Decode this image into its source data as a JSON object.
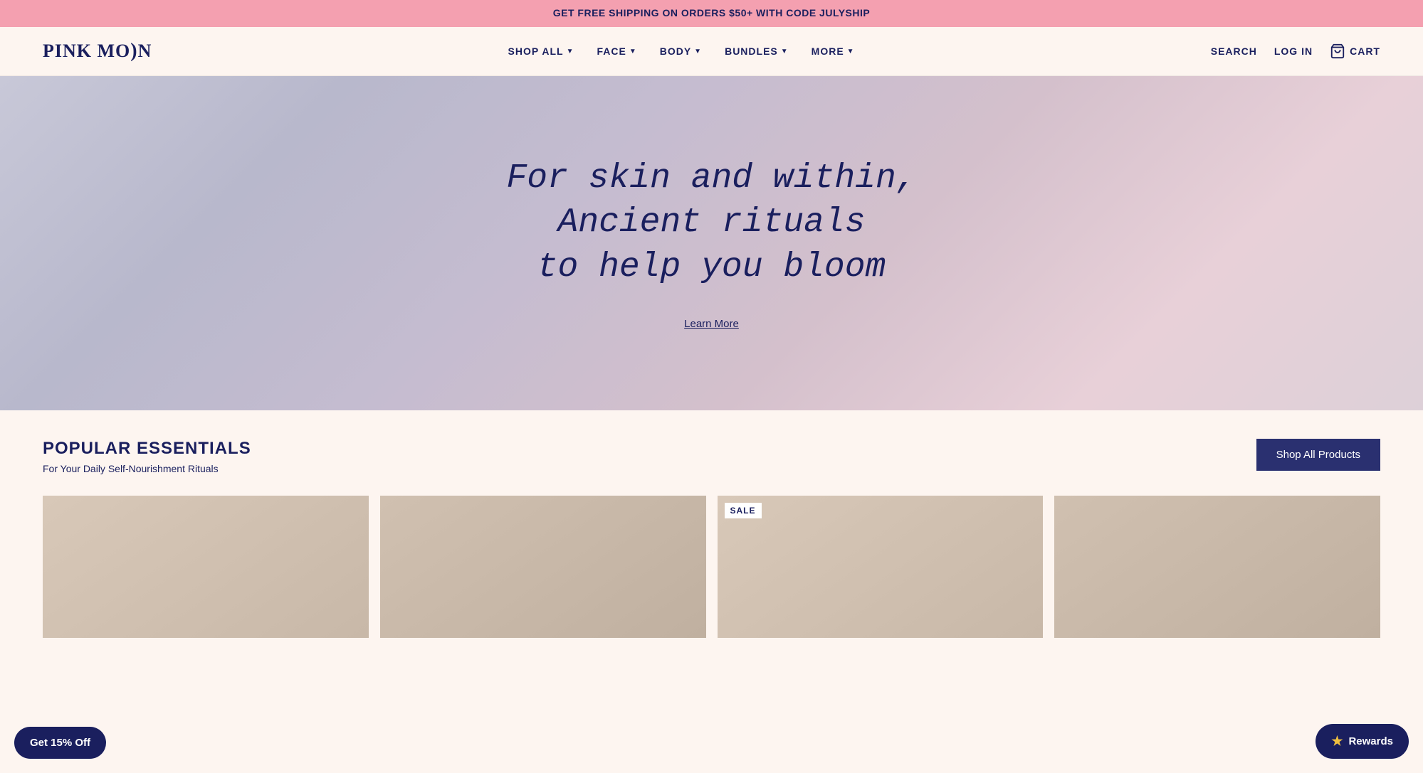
{
  "announcement": {
    "text": "GET FREE SHIPPING ON ORDERS $50+ WITH CODE JULYSHIP"
  },
  "header": {
    "logo": "PINK MO",
    "logo_moon": ")",
    "logo_n": "N",
    "nav_items": [
      {
        "label": "SHOP ALL",
        "has_dropdown": true
      },
      {
        "label": "FACE",
        "has_dropdown": true
      },
      {
        "label": "BODY",
        "has_dropdown": true
      },
      {
        "label": "BUNDLES",
        "has_dropdown": true
      },
      {
        "label": "MORE",
        "has_dropdown": true
      }
    ],
    "search_label": "SEARCH",
    "login_label": "LOG IN",
    "cart_label": "CART"
  },
  "hero": {
    "headline_line1": "For skin and within, Ancient rituals",
    "headline_line2": "to help you bloom",
    "cta_label": "Learn More"
  },
  "popular_essentials": {
    "title": "POPULAR ESSENTIALS",
    "subtitle": "For Your Daily Self-Nourishment Rituals",
    "shop_all_label": "Shop All Products",
    "sale_badge": "SALE"
  },
  "floating": {
    "discount_label": "Get 15% Off",
    "rewards_label": "Rewards",
    "star": "★"
  },
  "colors": {
    "navy": "#1a1f5e",
    "pink_announcement": "#f4a0b0",
    "hero_bg_start": "#c8c8d8",
    "hero_bg_end": "#e8d0d8",
    "cream": "#fdf5f0",
    "dark_button": "#2a3070"
  }
}
